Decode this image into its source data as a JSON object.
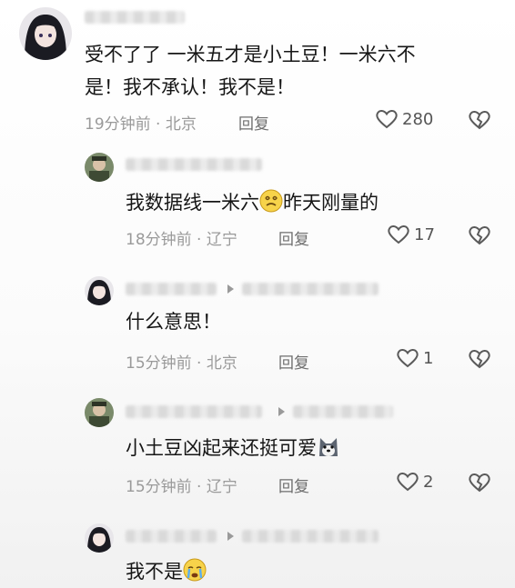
{
  "comments": [
    {
      "text_line1": "受不了了 一米五才是小土豆！一米六不",
      "text_line2": "是！我不承认！我不是！",
      "time": "19分钟前 · 北京",
      "reply_label": "回复",
      "likes": "280"
    },
    {
      "text_before": "我数据线一米六",
      "emoji": "dizzy-face-emoji",
      "text_after": "昨天刚量的",
      "time": "18分钟前 · 辽宁",
      "reply_label": "回复",
      "likes": "17"
    },
    {
      "text": "什么意思！",
      "time": "15分钟前 · 北京",
      "reply_label": "回复",
      "likes": "1"
    },
    {
      "text_before": "小土豆凶起来还挺可爱",
      "emoji": "husky-dog-emoji",
      "time": "15分钟前 · 辽宁",
      "reply_label": "回复",
      "likes": "2"
    },
    {
      "text_before": "我不是",
      "emoji": "crying-face-emoji"
    }
  ],
  "colors": {
    "text": "#161616",
    "meta": "#9a9a9a",
    "icon": "#5a5a5a"
  }
}
